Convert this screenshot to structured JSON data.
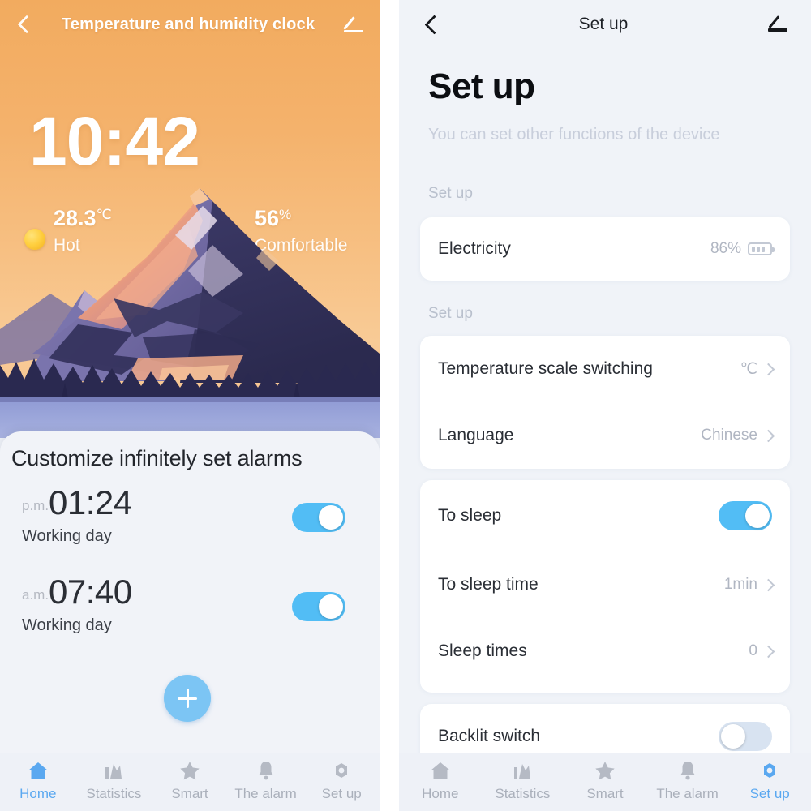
{
  "left": {
    "header": {
      "title": "Temperature and humidity clock",
      "back_icon": "chevron-left-icon",
      "edit_icon": "pencil-edit-icon"
    },
    "clock": "10:42",
    "metrics": [
      {
        "icon": "sun-icon",
        "value": "28.3",
        "unit": "℃",
        "status": "Hot"
      },
      {
        "icon": "water-drop-icon",
        "value": "56",
        "unit": "%",
        "status": "Comfortable"
      }
    ],
    "alarms": {
      "heading": "Customize infinitely set alarms",
      "items": [
        {
          "meridiem": "p.m.",
          "time": "01:24",
          "repeat": "Working day",
          "enabled": true
        },
        {
          "meridiem": "a.m.",
          "time": "07:40",
          "repeat": "Working day",
          "enabled": true
        }
      ],
      "add_label": "+"
    },
    "tabs": [
      {
        "label": "Home",
        "icon": "home-icon",
        "active": true
      },
      {
        "label": "Statistics",
        "icon": "bar-chart-icon",
        "active": false
      },
      {
        "label": "Smart",
        "icon": "star-icon",
        "active": false
      },
      {
        "label": "The alarm",
        "icon": "bell-icon",
        "active": false
      },
      {
        "label": "Set up",
        "icon": "gear-icon",
        "active": false
      }
    ]
  },
  "right": {
    "header": {
      "title": "Set up",
      "back_icon": "chevron-left-icon",
      "edit_icon": "pencil-edit-icon"
    },
    "page_title": "Set up",
    "page_subtitle": "You can set other functions of the device",
    "section_label_1": "Set up",
    "section_label_2": "Set up",
    "electricity": {
      "label": "Electricity",
      "value": "86%",
      "icon": "battery-icon"
    },
    "settings": [
      {
        "label": "Temperature scale switching",
        "value": "℃",
        "chevron": true
      },
      {
        "label": "Language",
        "value": "Chinese",
        "chevron": true
      }
    ],
    "sleep": {
      "toggle_row": {
        "label": "To sleep",
        "enabled": true
      },
      "rows": [
        {
          "label": "To sleep time",
          "value": "1min",
          "chevron": true
        },
        {
          "label": "Sleep times",
          "value": "0",
          "chevron": true
        }
      ]
    },
    "backlit": {
      "label": "Backlit switch",
      "enabled": false
    },
    "tabs": [
      {
        "label": "Home",
        "icon": "home-icon",
        "active": false
      },
      {
        "label": "Statistics",
        "icon": "bar-chart-icon",
        "active": false
      },
      {
        "label": "Smart",
        "icon": "star-icon",
        "active": false
      },
      {
        "label": "The alarm",
        "icon": "bell-icon",
        "active": false
      },
      {
        "label": "Set up",
        "icon": "gear-icon",
        "active": true
      }
    ]
  },
  "colors": {
    "accent_blue": "#52BDF5",
    "tab_active": "#5AA8F0",
    "sky_top": "#F2AB5F",
    "sky_bottom": "#F6C190",
    "sheet_bg": "#F1F3F8",
    "page_bg": "#F0F3F8",
    "card_bg": "#FFFFFF",
    "toggle_off": "#D8E3F1"
  }
}
